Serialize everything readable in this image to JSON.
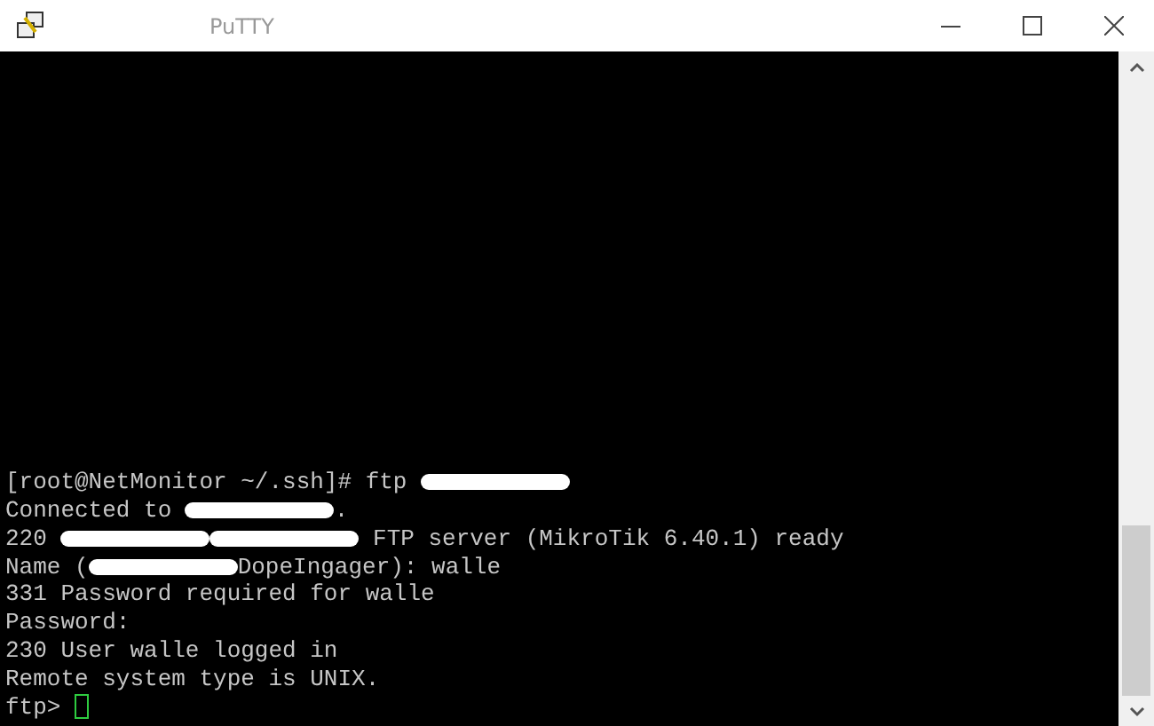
{
  "window": {
    "title": "PuTTY"
  },
  "terminal": {
    "lines": [
      [
        {
          "kind": "text",
          "text": "[root@NetMonitor ~/.ssh]# ftp "
        },
        {
          "kind": "redacted"
        }
      ],
      [
        {
          "kind": "text",
          "text": "Connected to "
        },
        {
          "kind": "redacted"
        },
        {
          "kind": "text",
          "text": "."
        }
      ],
      [
        {
          "kind": "text",
          "text": "220 "
        },
        {
          "kind": "redacted"
        },
        {
          "kind": "redacted"
        },
        {
          "kind": "text",
          "text": " FTP server (MikroTik 6.40.1) ready"
        }
      ],
      [
        {
          "kind": "text",
          "text": "Name ("
        },
        {
          "kind": "redacted"
        },
        {
          "kind": "text",
          "text": "DopeIngager): walle"
        }
      ],
      [
        {
          "kind": "text",
          "text": "331 Password required for walle"
        }
      ],
      [
        {
          "kind": "text",
          "text": "Password:"
        }
      ],
      [
        {
          "kind": "text",
          "text": "230 User walle logged in"
        }
      ],
      [
        {
          "kind": "text",
          "text": "Remote system type is UNIX."
        }
      ],
      [
        {
          "kind": "text",
          "text": "ftp> "
        },
        {
          "kind": "cursor"
        }
      ]
    ]
  }
}
